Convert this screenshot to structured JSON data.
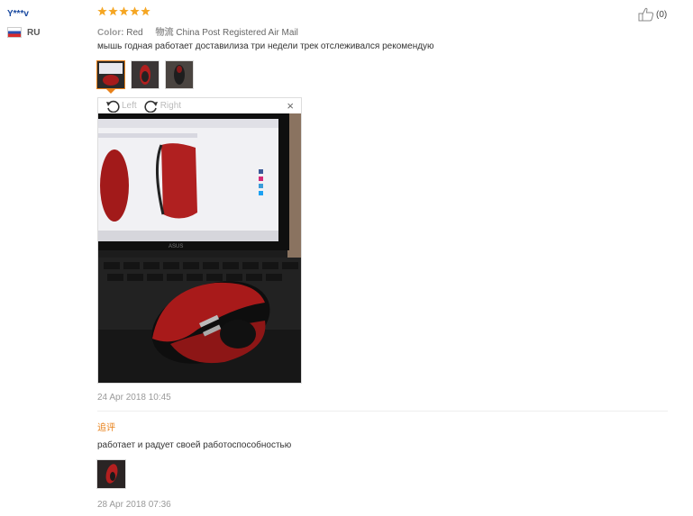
{
  "reviewer": {
    "name": "Y***v",
    "country": "RU",
    "flag_icon": "russia-flag-icon"
  },
  "rating": {
    "value": 5,
    "max": 5,
    "color": "#f5a623"
  },
  "helpful": {
    "count_label": "(0)",
    "icon": "thumbs-up-icon"
  },
  "attributes": {
    "color_label": "Color:",
    "color_value": "Red",
    "logistics_label": "物流",
    "logistics_value": "China Post Registered Air Mail"
  },
  "review": {
    "text": "мышь годная работает доставилиза три недели трек отслеживался рекомендую"
  },
  "viewer": {
    "rotate_left": "Left",
    "rotate_right": "Right",
    "close": "×"
  },
  "review_date": "24 Apr 2018 10:45",
  "followup": {
    "label": "追评",
    "text": "работает и радует своей работоспособностью",
    "date": "28 Apr 2018 07:36"
  },
  "colors": {
    "accent": "#e8811a",
    "username": "#1a4aa0"
  }
}
